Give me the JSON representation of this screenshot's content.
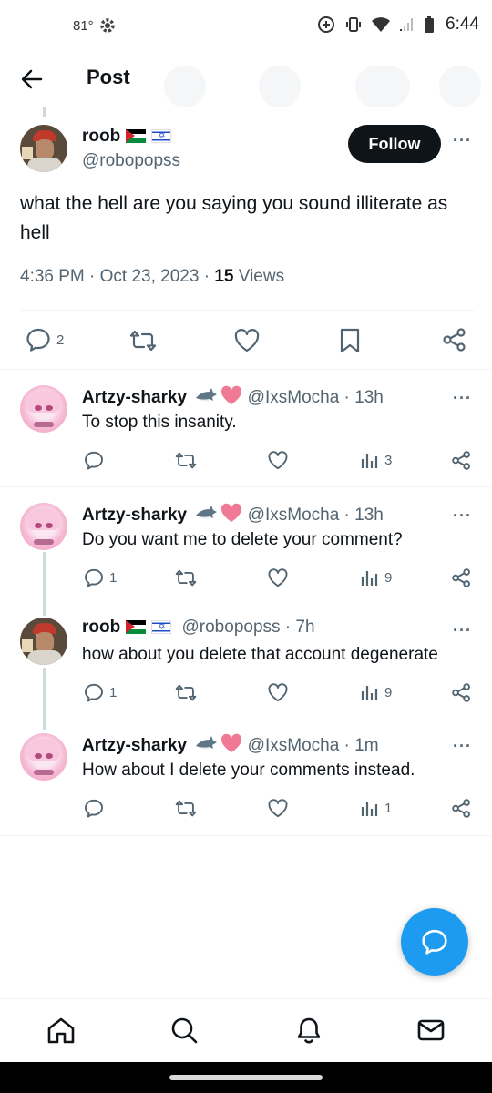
{
  "status_bar": {
    "temperature": "81°",
    "time": "6:44"
  },
  "header": {
    "title": "Post"
  },
  "main_post": {
    "name": "roob",
    "handle": "@robopopss",
    "follow_label": "Follow",
    "text": "what the hell are you saying you sound illiterate as hell",
    "timestamp": "4:36 PM · Oct 23, 2023 · ",
    "views_count": "15",
    "views_label": " Views",
    "reply_count": "2"
  },
  "replies": [
    {
      "name": "Artzy-sharky",
      "handle": "@IxsMocha · 13h",
      "text": "To stop this insanity.",
      "reply_count": "",
      "view_count": "3"
    },
    {
      "name": "Artzy-sharky",
      "handle": "@IxsMocha · 13h",
      "text": "Do you want me to delete your comment?",
      "reply_count": "1",
      "view_count": "9"
    },
    {
      "name": "roob",
      "handle": "@robopopss · 7h",
      "text": "how about you delete that account degenerate",
      "reply_count": "1",
      "view_count": "9"
    },
    {
      "name": "Artzy-sharky",
      "handle": "@IxsMocha · 1m",
      "text": "How about I delete your comments instead.",
      "reply_count": "",
      "view_count": "1"
    }
  ],
  "colors": {
    "accent": "#1d9bf0",
    "text": "#0f1419",
    "secondary": "#536471",
    "like_heart": "#f07a95"
  },
  "icons": [
    "back-arrow-icon",
    "reply-icon",
    "repost-icon",
    "like-icon",
    "bookmark-icon",
    "share-icon",
    "views-icon",
    "home-icon",
    "search-icon",
    "notifications-icon",
    "messages-icon",
    "compose-reply-icon"
  ]
}
